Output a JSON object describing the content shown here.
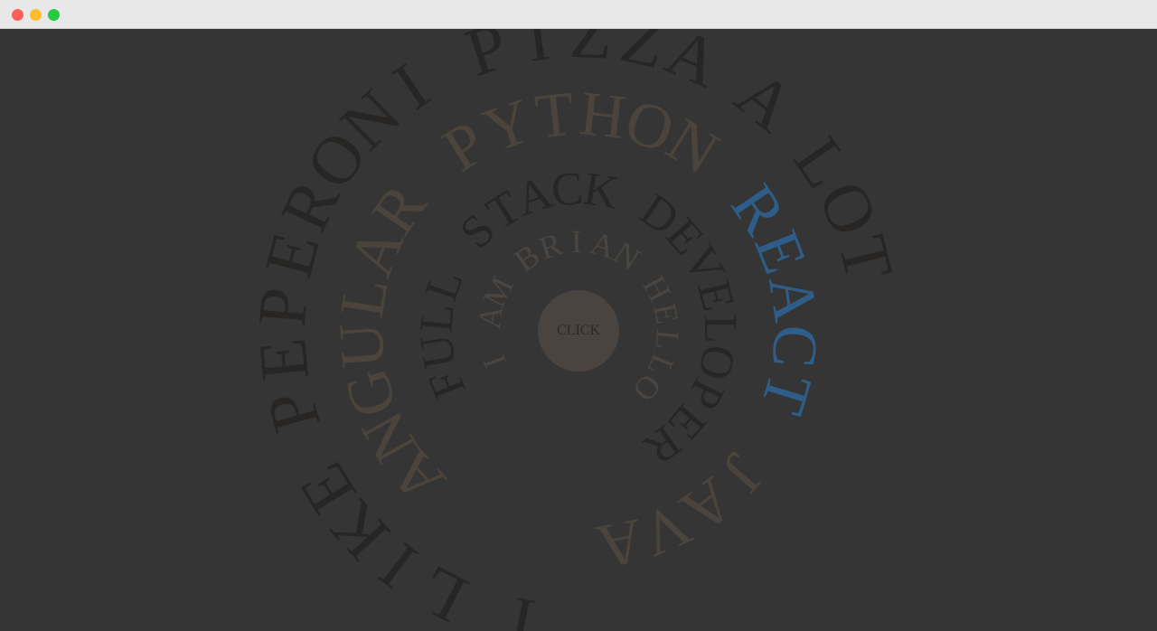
{
  "window": {
    "controls": [
      "close",
      "minimize",
      "maximize"
    ]
  },
  "colors": {
    "background": "#353535",
    "ring_outer": "#272624",
    "ring_mid": "#4b443c",
    "ring_inner": "#272624",
    "ring_name": "#4a4540",
    "highlight": "#2f5d8a",
    "button": "#4a4440",
    "button_text": "#2a2826"
  },
  "center_button": {
    "label": "CLICK"
  },
  "rings": [
    {
      "id": "outer",
      "words": [
        {
          "text": "I",
          "highlight": false
        },
        {
          "text": "LIKE",
          "highlight": false
        },
        {
          "text": "PEPERONI",
          "highlight": false
        },
        {
          "text": "PIZZA",
          "highlight": false
        },
        {
          "text": "A",
          "highlight": false
        },
        {
          "text": "LOT",
          "highlight": false
        }
      ]
    },
    {
      "id": "languages",
      "words": [
        {
          "text": "ANGULAR",
          "highlight": false
        },
        {
          "text": "PYTHON",
          "highlight": false
        },
        {
          "text": "REACT",
          "highlight": true
        },
        {
          "text": "JAVA",
          "highlight": false
        }
      ]
    },
    {
      "id": "role",
      "words": [
        {
          "text": "FULL",
          "highlight": false
        },
        {
          "text": "STACK",
          "highlight": false
        },
        {
          "text": "DEVELOPER",
          "highlight": false
        }
      ]
    },
    {
      "id": "name",
      "words": [
        {
          "text": "I",
          "highlight": false
        },
        {
          "text": "AM",
          "highlight": false
        },
        {
          "text": "BRIAN",
          "highlight": false
        },
        {
          "text": "HELLO",
          "highlight": false
        }
      ]
    }
  ]
}
